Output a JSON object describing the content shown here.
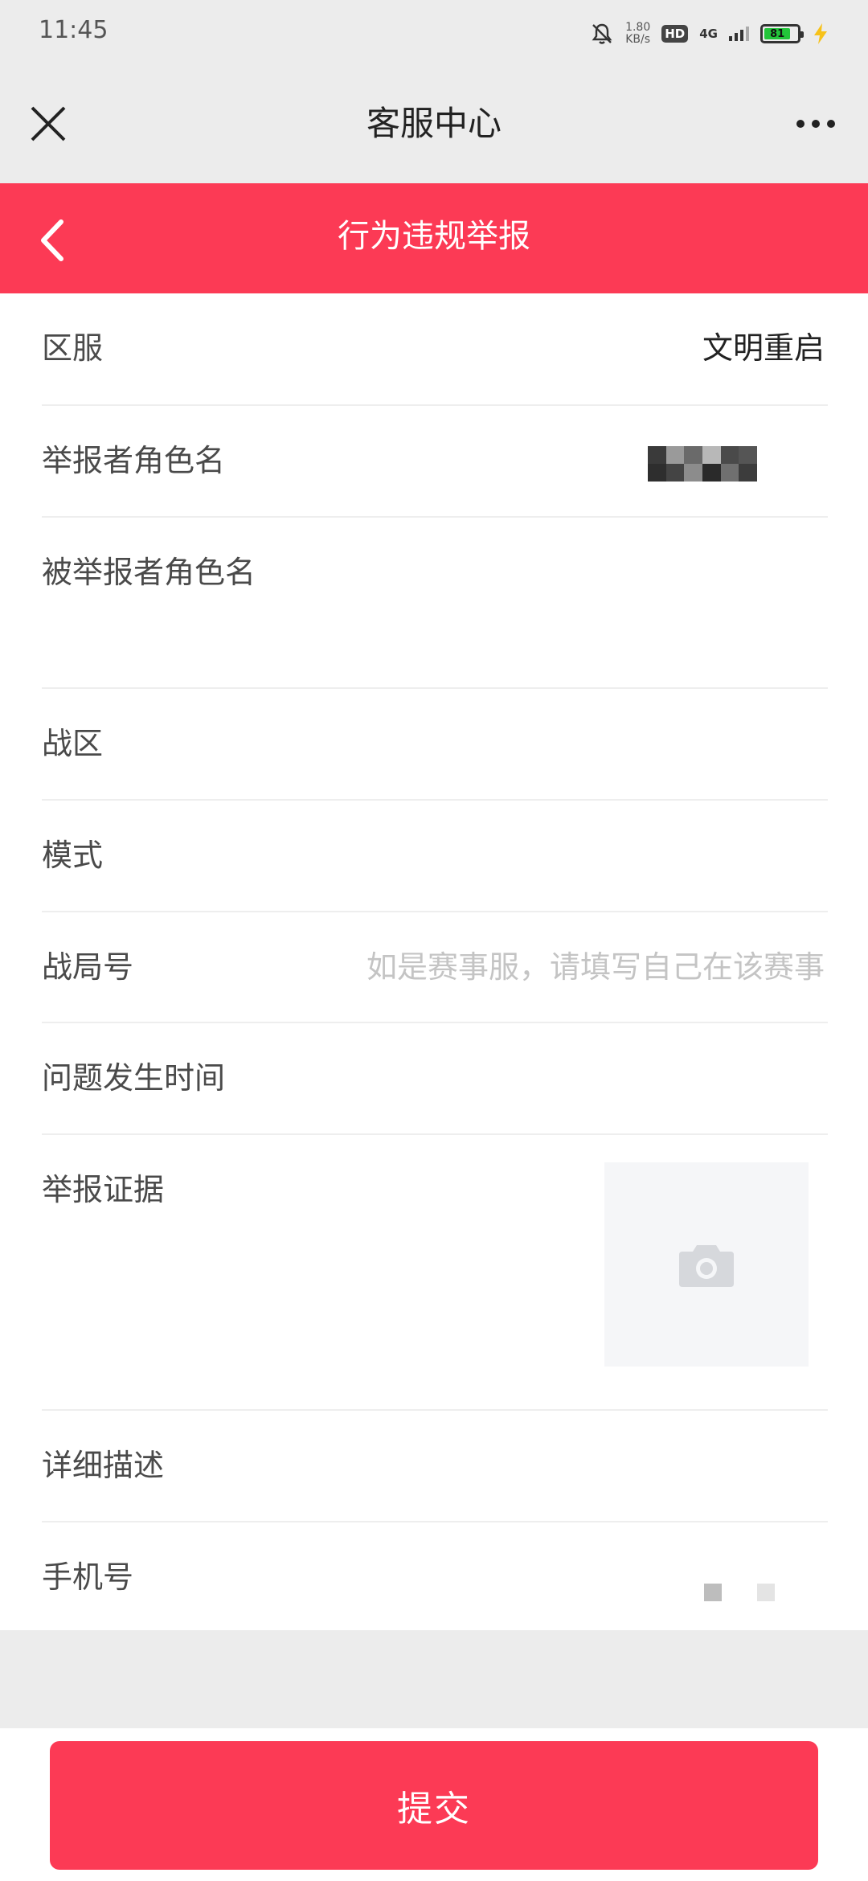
{
  "status_bar": {
    "time": "11:45",
    "net_speed_value": "1.80",
    "net_speed_unit": "KB/s",
    "hd": "HD",
    "network": "4G",
    "battery": "81",
    "icons": [
      "bell-off-icon",
      "signal-icon",
      "battery-icon",
      "charging-icon"
    ]
  },
  "title_bar": {
    "title": "客服中心",
    "icons": [
      "close-icon",
      "more-icon"
    ]
  },
  "header": {
    "title": "行为违规举报",
    "icons": [
      "back-arrow-icon"
    ]
  },
  "form": {
    "server": {
      "label": "区服",
      "value": "文明重启"
    },
    "reporter_role": {
      "label": "举报者角色名"
    },
    "reported_role": {
      "label": "被举报者角色名"
    },
    "battle_zone": {
      "label": "战区"
    },
    "mode": {
      "label": "模式"
    },
    "match_id": {
      "label": "战局号",
      "placeholder": "如是赛事服，请填写自己在该赛事"
    },
    "time": {
      "label": "问题发生时间"
    },
    "evidence": {
      "label": "举报证据",
      "icon": "camera-icon"
    },
    "description": {
      "label": "详细描述"
    },
    "phone": {
      "label": "手机号"
    }
  },
  "submit": {
    "label": "提交"
  },
  "colors": {
    "accent": "#fc3a55",
    "background": "#ececec",
    "placeholder": "#c4c4c4"
  }
}
